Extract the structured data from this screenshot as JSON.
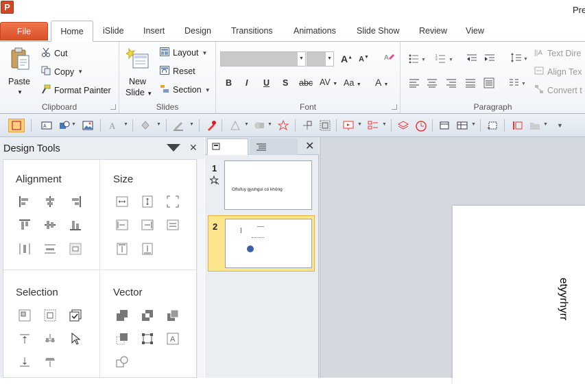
{
  "window": {
    "title": "Pre",
    "app_icon_letter": "P"
  },
  "tabs": [
    "File",
    "Home",
    "iSlide",
    "Insert",
    "Design",
    "Transitions",
    "Animations",
    "Slide Show",
    "Review",
    "View"
  ],
  "ribbon": {
    "clipboard": {
      "paste": "Paste",
      "cut": "Cut",
      "copy": "Copy",
      "format_painter": "Format Painter",
      "label": "Clipboard"
    },
    "slides": {
      "new_slide_line1": "New",
      "new_slide_line2": "Slide",
      "layout": "Layout",
      "reset": "Reset",
      "section": "Section",
      "label": "Slides"
    },
    "font": {
      "label": "Font",
      "bold": "B",
      "italic": "I",
      "underline": "U",
      "shadow": "S",
      "strike": "abc",
      "spacing": "AV",
      "case": "Aa",
      "color": "A",
      "grow": "A",
      "shrink": "A"
    },
    "paragraph": {
      "label": "Paragraph",
      "text_direction": "Text Dire",
      "align_text": "Align Tex",
      "convert": "Convert t"
    }
  },
  "design_tools": {
    "title": "Design Tools",
    "sections": {
      "alignment": "Alignment",
      "size": "Size",
      "selection": "Selection",
      "vector": "Vector"
    }
  },
  "slides_pane": {
    "slides": [
      {
        "number": "1",
        "text": "Gftufuy gyuhgui có không"
      },
      {
        "number": "2",
        "text": ""
      }
    ]
  },
  "canvas": {
    "visible_text": "etyyrhyrr"
  },
  "colors": {
    "file_tab": "#d9502a",
    "selected_thumb": "#fde58e",
    "accent_red": "#e04040",
    "accent_blue": "#3b6fb6"
  }
}
